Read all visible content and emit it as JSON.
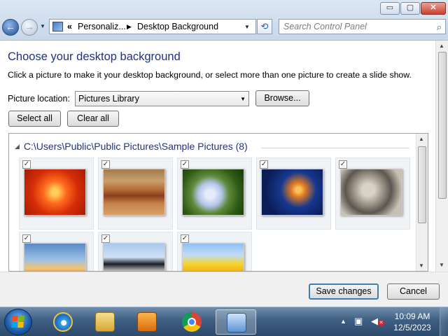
{
  "window": {
    "minimize_label": "▭",
    "maximize_label": "▢",
    "close_label": "✕"
  },
  "address_bar": {
    "root_glyph": "«",
    "crumbs": [
      "Personaliz...",
      "Desktop Background"
    ],
    "separator_glyph": "▶",
    "dropdown_glyph": "▼",
    "refresh_glyph": "⟲"
  },
  "search": {
    "placeholder": "Search Control Panel",
    "icon": "magnifier-icon"
  },
  "page": {
    "title": "Choose your desktop background",
    "subtitle": "Click a picture to make it your desktop background, or select more than one picture to create a slide show.",
    "picture_location_label": "Picture location:",
    "picture_location_value": "Pictures Library",
    "browse_label": "Browse...",
    "select_all_label": "Select all",
    "clear_all_label": "Clear all"
  },
  "gallery": {
    "folder_path": "C:\\Users\\Public\\Public Pictures\\Sample Pictures (8)",
    "collapse_glyph": "◢",
    "items": [
      {
        "name": "chrysanthemum",
        "checked": true
      },
      {
        "name": "desert",
        "checked": true
      },
      {
        "name": "hydrangeas",
        "checked": true
      },
      {
        "name": "jellyfish",
        "checked": true
      },
      {
        "name": "koala",
        "checked": true
      },
      {
        "name": "lighthouse",
        "checked": true
      },
      {
        "name": "penguins",
        "checked": true
      },
      {
        "name": "tulips",
        "checked": true
      }
    ],
    "checkmark": "✓"
  },
  "footer": {
    "save_label": "Save changes",
    "cancel_label": "Cancel"
  },
  "taskbar": {
    "time": "10:09 AM",
    "date": "12/5/2023",
    "tray_arrow": "▲",
    "volume_mute_glyph": "✕"
  },
  "colors": {
    "title_blue": "#1e3287",
    "taskbar_top": "#6f8dab",
    "taskbar_bottom": "#2c4a6c"
  }
}
